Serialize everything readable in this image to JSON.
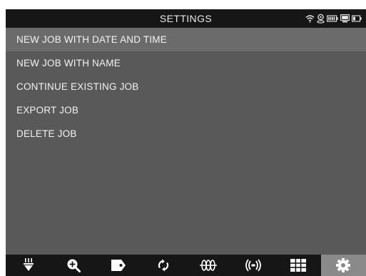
{
  "header": {
    "title": "SETTINGS",
    "status_icons": [
      "wifi-icon",
      "gps-icon",
      "battery-icon",
      "storage-icon",
      "battery-small-icon"
    ]
  },
  "menu": {
    "items": [
      {
        "label": "NEW JOB WITH DATE AND TIME",
        "selected": true
      },
      {
        "label": "NEW JOB WITH NAME",
        "selected": false
      },
      {
        "label": "CONTINUE EXISTING JOB",
        "selected": false
      },
      {
        "label": "EXPORT JOB",
        "selected": false
      },
      {
        "label": "DELETE JOB",
        "selected": false
      }
    ]
  },
  "toolbar": {
    "items": [
      {
        "icon": "measure-down-icon",
        "active": false
      },
      {
        "icon": "zoom-in-icon",
        "active": false
      },
      {
        "icon": "tag-icon",
        "active": false
      },
      {
        "icon": "refresh-icon",
        "active": false
      },
      {
        "icon": "waveform-icon",
        "active": false
      },
      {
        "icon": "signal-icon",
        "active": false
      },
      {
        "icon": "grid-icon",
        "active": false
      },
      {
        "icon": "settings-gear-icon",
        "active": true
      }
    ]
  },
  "colors": {
    "background": "#595959",
    "bar": "#161616",
    "selected_row": "#6b6b6b",
    "active_tool": "#8a8a8a",
    "text": "#f2f2f2"
  }
}
